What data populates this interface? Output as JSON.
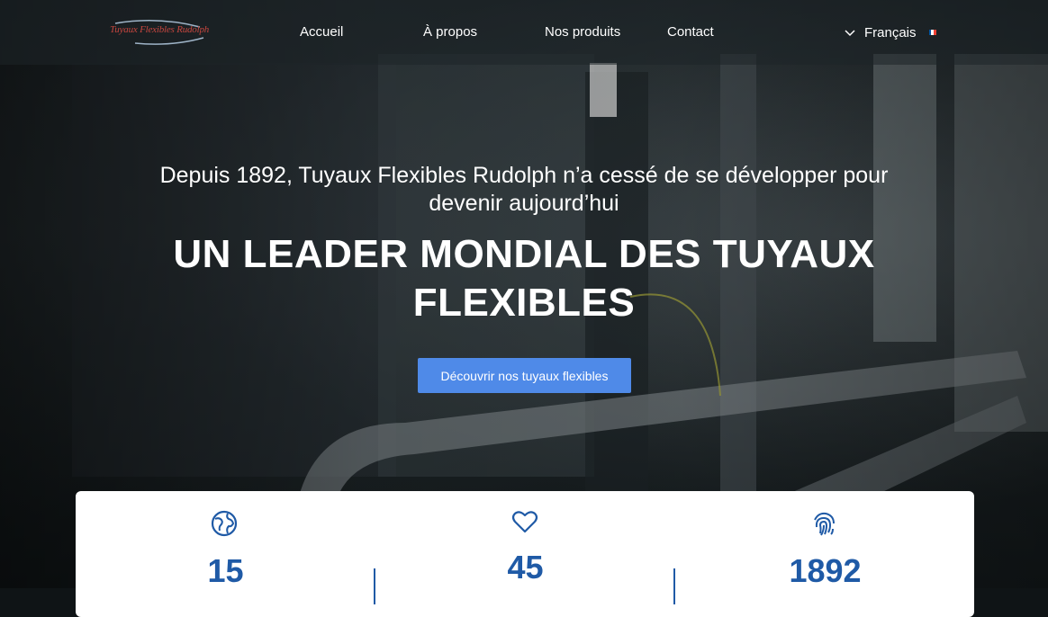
{
  "header": {
    "logo_text": "Tuyaux Flexibles Rudolph",
    "nav": [
      "Accueil",
      "À propos",
      "Nos produits",
      "Contact"
    ],
    "language": "Français",
    "language_flag_colors": [
      "#0055a4",
      "#ffffff",
      "#ef4135"
    ]
  },
  "hero": {
    "intro": "Depuis 1892, Tuyaux Flexibles Rudolph n’a cessé de se développer pour devenir aujourd’hui",
    "headline": "UN LEADER MONDIAL DES TUYAUX FLEXIBLES",
    "cta_label": "Découvrir nos tuyaux flexibles",
    "cta_color": "#4f8ae8"
  },
  "stats": [
    {
      "icon": "globe-icon",
      "value": "15"
    },
    {
      "icon": "heart-icon",
      "value": "45"
    },
    {
      "icon": "fingerprint-icon",
      "value": "1892"
    }
  ],
  "colors": {
    "accent": "#1f5aa6",
    "brand_red": "#c6463f"
  }
}
